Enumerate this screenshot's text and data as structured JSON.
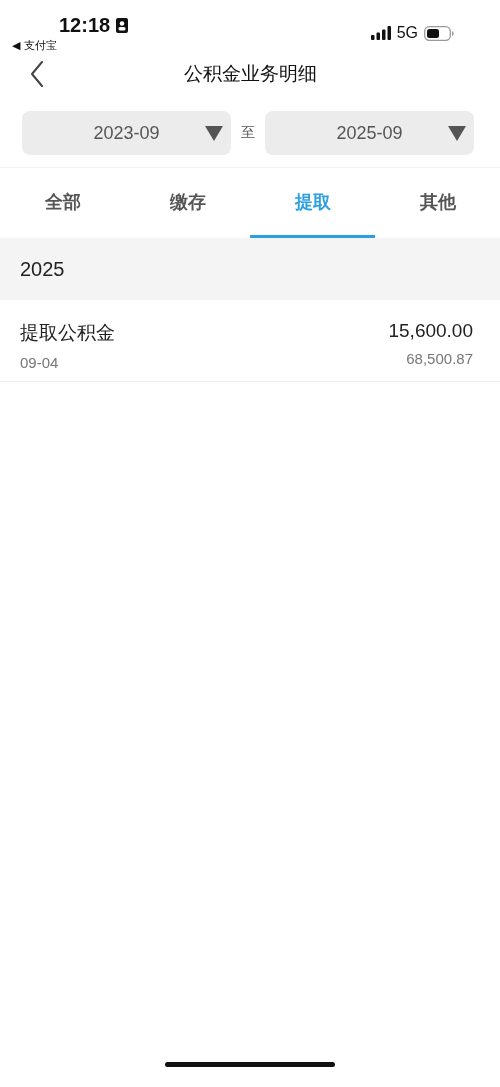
{
  "status_bar": {
    "time": "12:18",
    "back_app": "◀ 支付宝",
    "network": "5G"
  },
  "header": {
    "title": "公积金业务明细"
  },
  "date_range": {
    "from": "2023-09",
    "separator": "至",
    "to": "2025-09"
  },
  "tabs": [
    {
      "label": "全部",
      "selected": false
    },
    {
      "label": "缴存",
      "selected": false
    },
    {
      "label": "提取",
      "selected": true
    },
    {
      "label": "其他",
      "selected": false
    }
  ],
  "groups": [
    {
      "year": "2025",
      "records": [
        {
          "title": "提取公积金",
          "date": "09-04",
          "amount": "15,600.00",
          "balance": "68,500.87"
        }
      ]
    }
  ]
}
